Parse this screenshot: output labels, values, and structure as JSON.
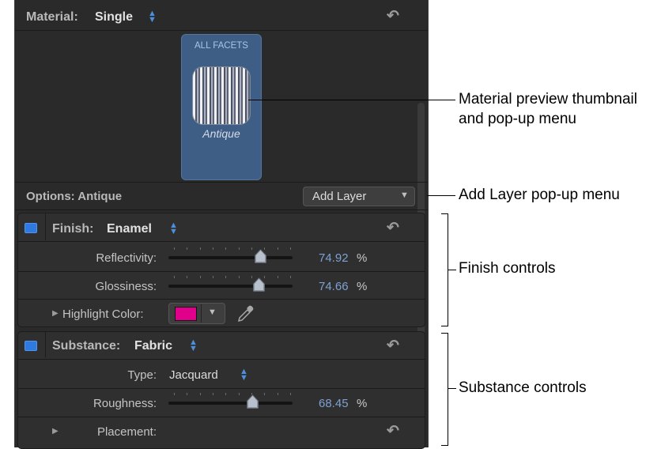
{
  "material": {
    "label": "Material:",
    "value": "Single"
  },
  "preview": {
    "facets_label": "ALL FACETS",
    "material_name": "Antique"
  },
  "options": {
    "label": "Options: Antique",
    "add_layer": "Add Layer"
  },
  "finish": {
    "label": "Finish:",
    "value": "Enamel",
    "reflectivity": {
      "label": "Reflectivity:",
      "value": "74.92",
      "unit": "%",
      "fraction": 0.74
    },
    "glossiness": {
      "label": "Glossiness:",
      "value": "74.66",
      "unit": "%",
      "fraction": 0.73
    },
    "highlight": {
      "label": "Highlight Color:",
      "color": "#e1008c"
    }
  },
  "substance": {
    "label": "Substance:",
    "value": "Fabric",
    "type": {
      "label": "Type:",
      "value": "Jacquard"
    },
    "roughness": {
      "label": "Roughness:",
      "value": "68.45",
      "unit": "%",
      "fraction": 0.68
    },
    "placement": {
      "label": "Placement:"
    }
  },
  "callouts": {
    "preview_line1": "Material preview thumbnail",
    "preview_line2": "and pop-up menu",
    "add_layer": "Add Layer pop-up menu",
    "finish": "Finish controls",
    "substance": "Substance controls"
  },
  "colors": {
    "accent": "#4d8fdc",
    "value_text": "#7da1d2",
    "tile": "#3f5e86"
  }
}
